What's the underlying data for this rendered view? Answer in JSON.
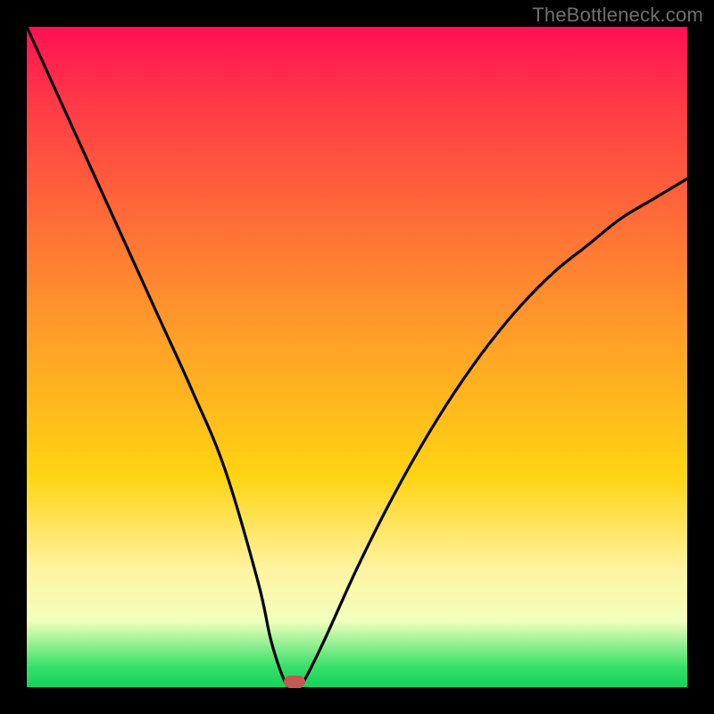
{
  "watermark": "TheBottleneck.com",
  "colors": {
    "top": "#ff1054",
    "red": "#ff3b46",
    "orange": "#ff9a2a",
    "yellow": "#ffd412",
    "pale": "#fff3a0",
    "pale2": "#f1ffbc",
    "green": "#35e06a",
    "green2": "#18d05b",
    "curve": "#000000",
    "marker": "#c15a54"
  },
  "chart_data": {
    "type": "line",
    "title": "",
    "xlabel": "",
    "ylabel": "",
    "xlim": [
      0,
      100
    ],
    "ylim": [
      0,
      100
    ],
    "series": [
      {
        "name": "bottleneck-curve",
        "x": [
          0,
          5,
          10,
          15,
          20,
          25,
          30,
          35,
          37,
          39,
          40,
          41,
          42,
          45,
          50,
          55,
          60,
          65,
          70,
          75,
          80,
          85,
          90,
          95,
          100
        ],
        "y": [
          100,
          89,
          78,
          67,
          56,
          45,
          33,
          16,
          7,
          1,
          0,
          0,
          1,
          7,
          18,
          28,
          37,
          45,
          52,
          58,
          63,
          67,
          71,
          74,
          77
        ]
      }
    ],
    "marker": {
      "x": 40.5,
      "y": 0.8
    },
    "notes": "V-shaped curve with minimum near x≈40; left branch reaches y=100 at x=0, right branch rises to y≈77 at x=100. Values estimated from pixel geometry."
  }
}
